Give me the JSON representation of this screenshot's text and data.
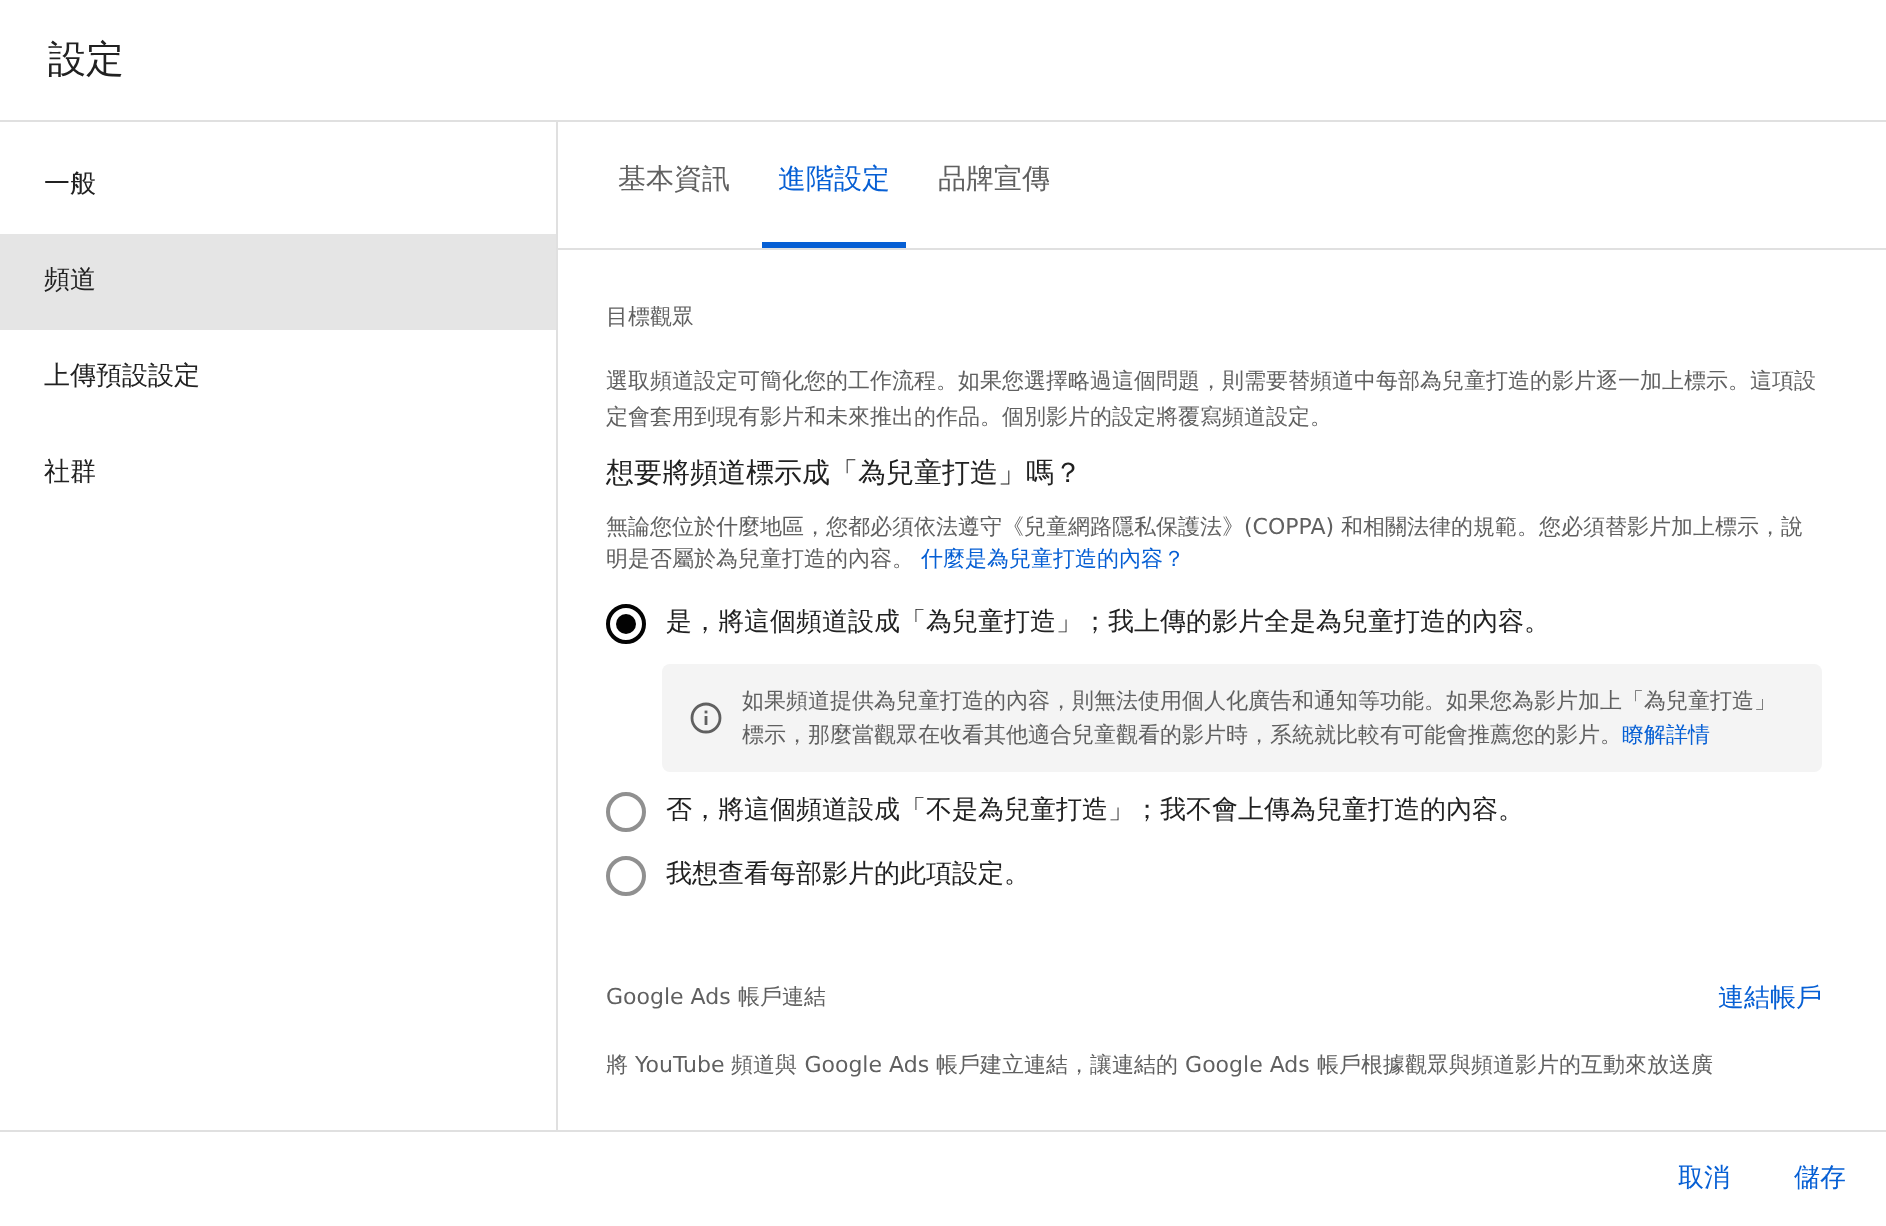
{
  "window": {
    "title": "設定"
  },
  "sidebar": {
    "items": [
      {
        "label": "一般",
        "selected": false
      },
      {
        "label": "頻道",
        "selected": true
      },
      {
        "label": "上傳預設設定",
        "selected": false
      },
      {
        "label": "社群",
        "selected": false
      }
    ]
  },
  "tabs": [
    {
      "label": "基本資訊",
      "selected": false
    },
    {
      "label": "進階設定",
      "selected": true
    },
    {
      "label": "品牌宣傳",
      "selected": false
    }
  ],
  "audience": {
    "heading": "目標觀眾",
    "description": "選取頻道設定可簡化您的工作流程。如果您選擇略過這個問題，則需要替頻道中每部為兒童打造的影片逐一加上標示。這項設定會套用到現有影片和未來推出的作品。個別影片的設定將覆寫頻道設定。",
    "question": "想要將頻道標示成「為兒童打造」嗎？",
    "notice": "無論您位於什麼地區，您都必須依法遵守《兒童網路隱私保護法》(COPPA) 和相關法律的規範。您必須替影片加上標示，說明是否屬於為兒童打造的內容。",
    "notice_link": "什麼是為兒童打造的內容？",
    "options": [
      {
        "label": "是，將這個頻道設成「為兒童打造」；我上傳的影片全是為兒童打造的內容。",
        "selected": true,
        "info": "如果頻道提供為兒童打造的內容，則無法使用個人化廣告和通知等功能。如果您為影片加上「為兒童打造」標示，那麼當觀眾在收看其他適合兒童觀看的影片時，系統就比較有可能會推薦您的影片。",
        "info_link": "瞭解詳情"
      },
      {
        "label": "否，將這個頻道設成「不是為兒童打造」；我不會上傳為兒童打造的內容。",
        "selected": false
      },
      {
        "label": "我想查看每部影片的此項設定。",
        "selected": false
      }
    ]
  },
  "google_ads": {
    "heading": "Google Ads 帳戶連結",
    "link": "連結帳戶",
    "description": "將 YouTube 頻道與 Google Ads 帳戶建立連結，讓連結的 Google Ads 帳戶根據觀眾與頻道影片的互動來放送廣"
  },
  "buttons": [
    {
      "label": "取消"
    },
    {
      "label": "儲存"
    }
  ]
}
